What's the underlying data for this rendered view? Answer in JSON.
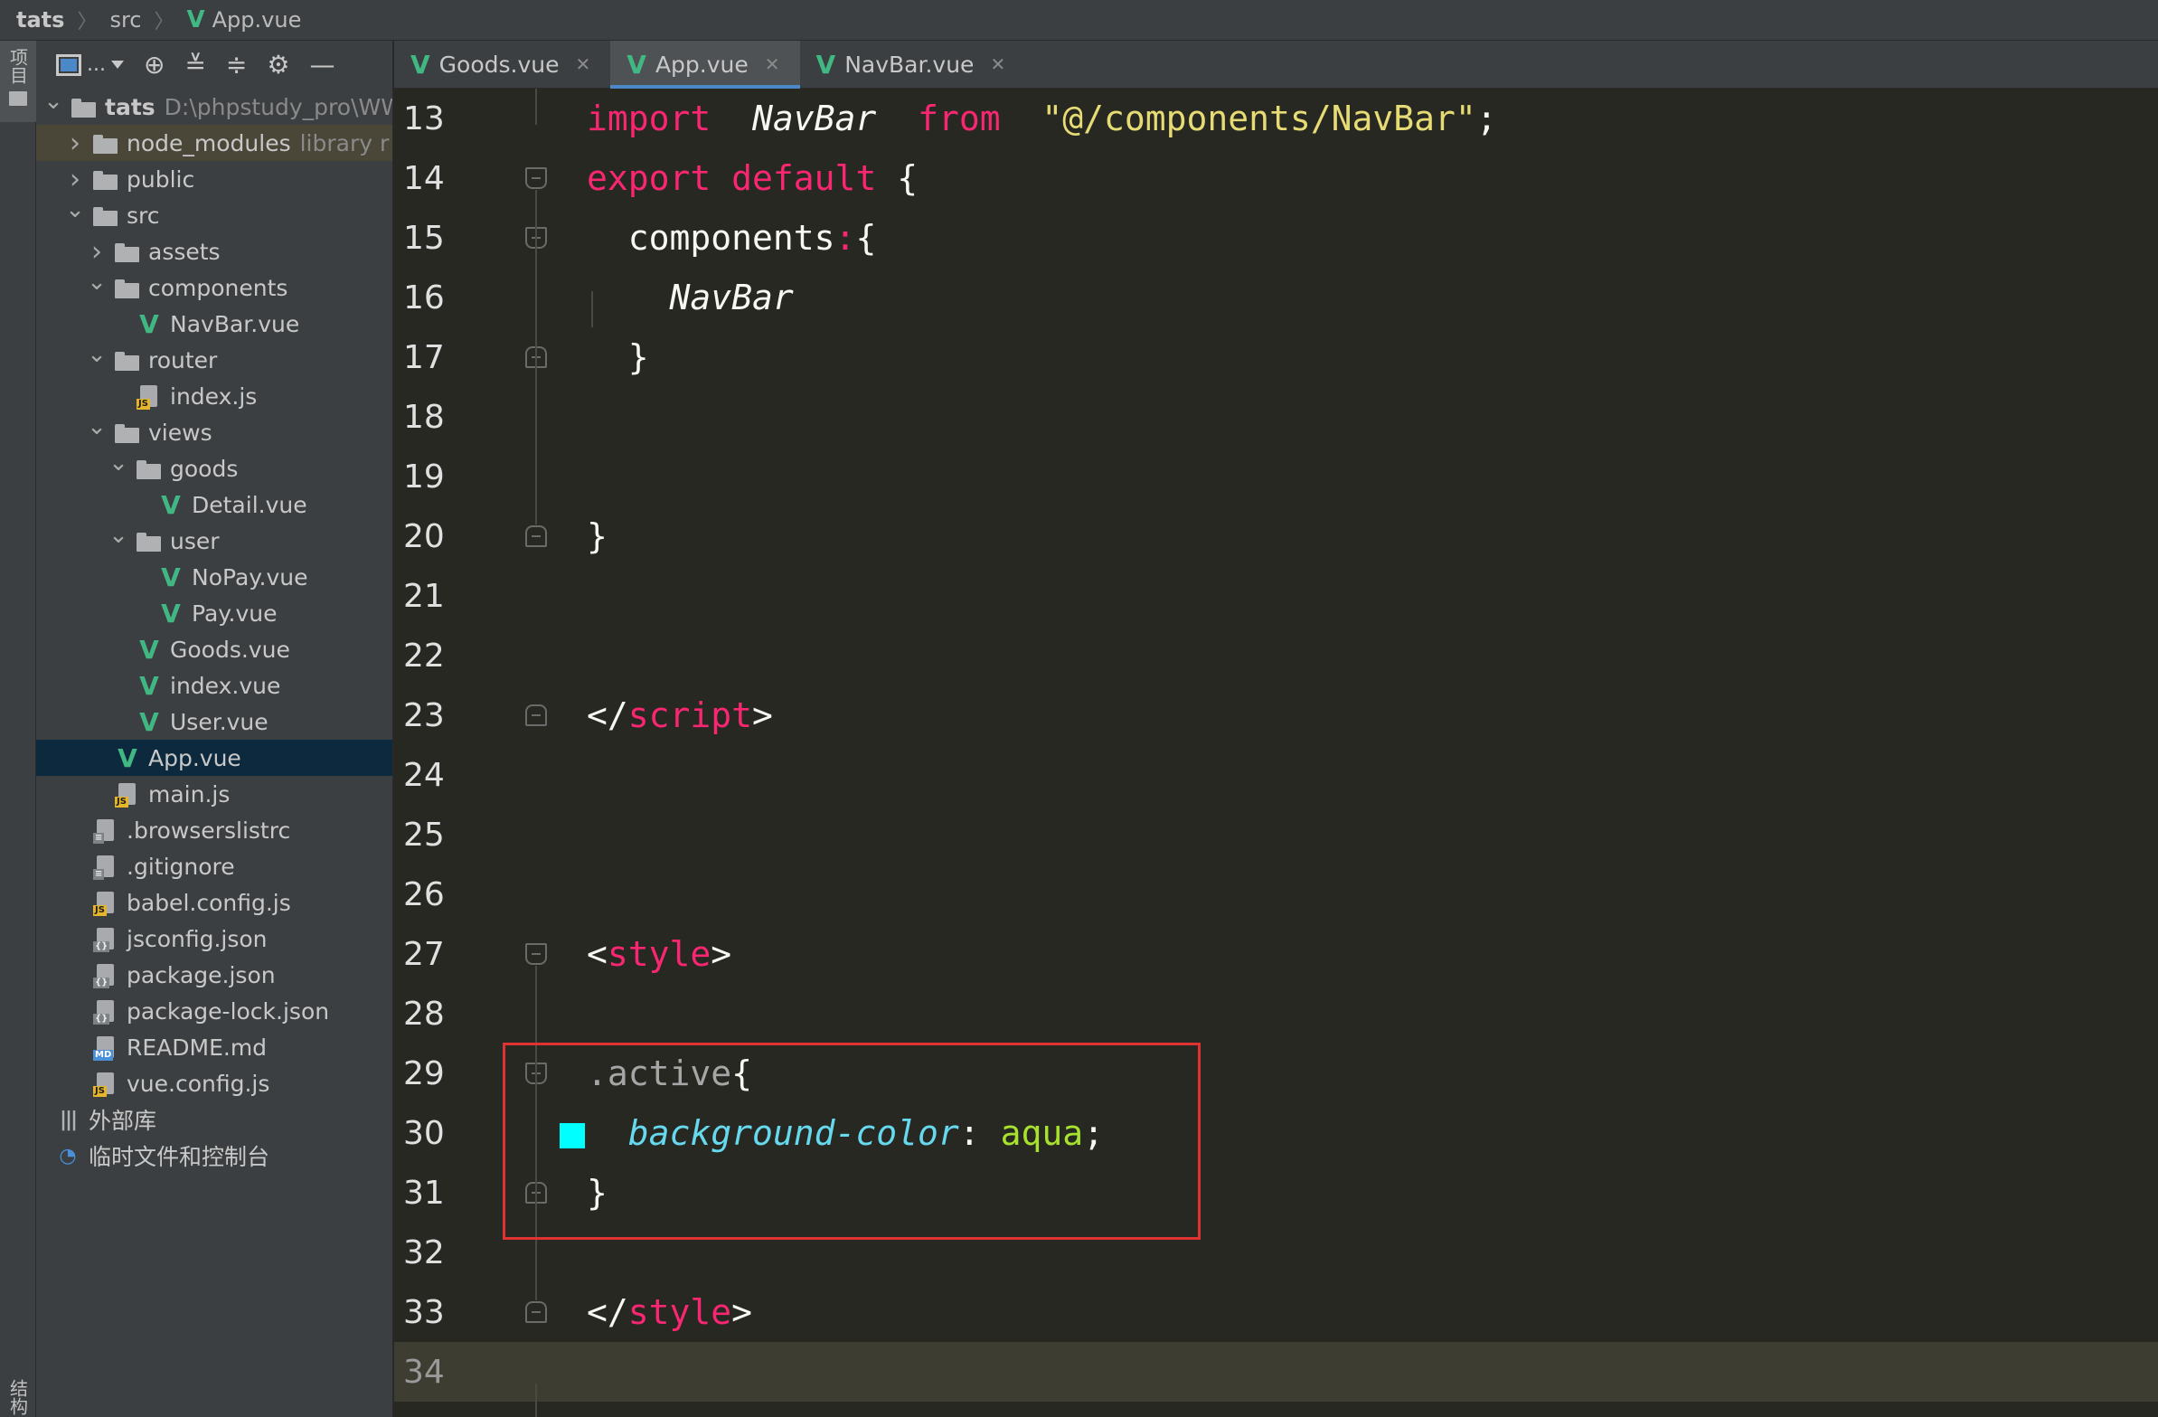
{
  "breadcrumb": {
    "items": [
      "tats",
      "src",
      "App.vue"
    ]
  },
  "tool_strip": {
    "project_label": "项目",
    "structure_label": "结构"
  },
  "project_panel": {
    "toolbar_dots": "...",
    "tree": [
      {
        "label": "tats",
        "hint": "D:\\phpstudy_pro\\WW",
        "type": "folder",
        "depth": 0,
        "arrow": "open",
        "bold": true
      },
      {
        "label": "node_modules",
        "hint": "library r",
        "type": "folder",
        "depth": 1,
        "arrow": "closed",
        "excluded": true
      },
      {
        "label": "public",
        "type": "folder",
        "depth": 1,
        "arrow": "closed"
      },
      {
        "label": "src",
        "type": "folder",
        "depth": 1,
        "arrow": "open"
      },
      {
        "label": "assets",
        "type": "folder",
        "depth": 2,
        "arrow": "closed"
      },
      {
        "label": "components",
        "type": "folder",
        "depth": 2,
        "arrow": "open"
      },
      {
        "label": "NavBar.vue",
        "type": "vue",
        "depth": 3,
        "arrow": "none"
      },
      {
        "label": "router",
        "type": "folder",
        "depth": 2,
        "arrow": "open"
      },
      {
        "label": "index.js",
        "type": "js",
        "depth": 3,
        "arrow": "none"
      },
      {
        "label": "views",
        "type": "folder",
        "depth": 2,
        "arrow": "open"
      },
      {
        "label": "goods",
        "type": "folder",
        "depth": 3,
        "arrow": "open"
      },
      {
        "label": "Detail.vue",
        "type": "vue",
        "depth": 4,
        "arrow": "none"
      },
      {
        "label": "user",
        "type": "folder",
        "depth": 3,
        "arrow": "open"
      },
      {
        "label": "NoPay.vue",
        "type": "vue",
        "depth": 4,
        "arrow": "none"
      },
      {
        "label": "Pay.vue",
        "type": "vue",
        "depth": 4,
        "arrow": "none"
      },
      {
        "label": "Goods.vue",
        "type": "vue",
        "depth": 3,
        "arrow": "none"
      },
      {
        "label": "index.vue",
        "type": "vue",
        "depth": 3,
        "arrow": "none"
      },
      {
        "label": "User.vue",
        "type": "vue",
        "depth": 3,
        "arrow": "none"
      },
      {
        "label": "App.vue",
        "type": "vue",
        "depth": 2,
        "arrow": "none",
        "selected": true
      },
      {
        "label": "main.js",
        "type": "js",
        "depth": 2,
        "arrow": "none"
      },
      {
        "label": ".browserslistrc",
        "type": "text",
        "depth": 1,
        "arrow": "none"
      },
      {
        "label": ".gitignore",
        "type": "text",
        "depth": 1,
        "arrow": "none"
      },
      {
        "label": "babel.config.js",
        "type": "js",
        "depth": 1,
        "arrow": "none"
      },
      {
        "label": "jsconfig.json",
        "type": "json",
        "depth": 1,
        "arrow": "none"
      },
      {
        "label": "package.json",
        "type": "json",
        "depth": 1,
        "arrow": "none"
      },
      {
        "label": "package-lock.json",
        "type": "json",
        "depth": 1,
        "arrow": "none"
      },
      {
        "label": "README.md",
        "type": "md",
        "depth": 1,
        "arrow": "none"
      },
      {
        "label": "vue.config.js",
        "type": "js",
        "depth": 1,
        "arrow": "none"
      },
      {
        "label": "外部库",
        "type": "library",
        "depth": 0.5,
        "arrow": "none"
      },
      {
        "label": "临时文件和控制台",
        "type": "scratch",
        "depth": 0.5,
        "arrow": "none"
      }
    ]
  },
  "tabs": [
    {
      "label": "Goods.vue",
      "active": false
    },
    {
      "label": "App.vue",
      "active": true
    },
    {
      "label": "NavBar.vue",
      "active": false
    }
  ],
  "editor": {
    "current_line": 34,
    "lines": [
      {
        "n": "13",
        "tokens": [
          [
            "kw",
            "import"
          ],
          [
            "",
            "  "
          ],
          [
            "it",
            "NavBar"
          ],
          [
            "",
            "  "
          ],
          [
            "kw",
            "from"
          ],
          [
            "",
            "  "
          ],
          [
            "str",
            "\"@/components/NavBar\""
          ],
          [
            "",
            ";"
          ]
        ]
      },
      {
        "n": "14",
        "tokens": [
          [
            "kw",
            "export"
          ],
          [
            "",
            " "
          ],
          [
            "kw",
            "default"
          ],
          [
            "",
            " {"
          ]
        ]
      },
      {
        "n": "15",
        "tokens": [
          [
            "",
            "  components"
          ],
          [
            "colon",
            ":"
          ],
          [
            "",
            "{"
          ]
        ]
      },
      {
        "n": "16",
        "tokens": [
          [
            "it",
            "    NavBar"
          ]
        ]
      },
      {
        "n": "17",
        "tokens": [
          [
            "",
            "  }"
          ]
        ]
      },
      {
        "n": "18",
        "tokens": []
      },
      {
        "n": "19",
        "tokens": []
      },
      {
        "n": "20",
        "tokens": [
          [
            "",
            "}"
          ]
        ]
      },
      {
        "n": "21",
        "tokens": []
      },
      {
        "n": "22",
        "tokens": []
      },
      {
        "n": "23",
        "tokens": [
          [
            "",
            "</"
          ],
          [
            "tag",
            "script"
          ],
          [
            "",
            ">"
          ]
        ]
      },
      {
        "n": "24",
        "tokens": []
      },
      {
        "n": "25",
        "tokens": []
      },
      {
        "n": "26",
        "tokens": []
      },
      {
        "n": "27",
        "tokens": [
          [
            "",
            "<"
          ],
          [
            "tag",
            "style"
          ],
          [
            "",
            ">"
          ]
        ]
      },
      {
        "n": "28",
        "tokens": []
      },
      {
        "n": "29",
        "tokens": [
          [
            "sel",
            ".active"
          ],
          [
            "",
            "{"
          ]
        ]
      },
      {
        "n": "30",
        "tokens": [
          [
            "",
            "  "
          ],
          [
            "prop",
            "background-color"
          ],
          [
            "",
            ": "
          ],
          [
            "val",
            "aqua"
          ],
          [
            "",
            ";"
          ]
        ],
        "swatch": "#00ffff"
      },
      {
        "n": "31",
        "tokens": [
          [
            "",
            "}"
          ]
        ]
      },
      {
        "n": "32",
        "tokens": []
      },
      {
        "n": "33",
        "tokens": [
          [
            "",
            "</"
          ],
          [
            "tag",
            "style"
          ],
          [
            "",
            ">"
          ]
        ]
      },
      {
        "n": "34",
        "tokens": []
      }
    ]
  },
  "colors": {
    "vue_green": "#41b883",
    "accent_blue": "#4a88c7",
    "highlight_red": "#e03232",
    "swatch_aqua": "#00ffff"
  }
}
